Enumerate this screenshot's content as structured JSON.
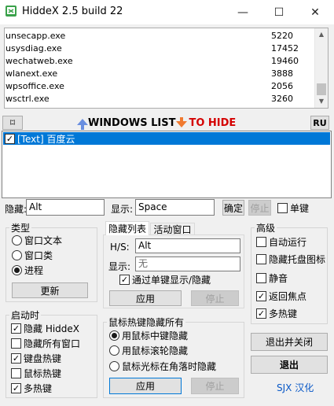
{
  "window": {
    "title": "HiddeX 2.5 build 22",
    "minimize_glyph": "—",
    "maximize_glyph": "☐",
    "close_glyph": "✕"
  },
  "process_list": [
    {
      "name": "unsecapp.exe",
      "pid": "5220"
    },
    {
      "name": "usysdiag.exe",
      "pid": "17452"
    },
    {
      "name": "wechatweb.exe",
      "pid": "19460"
    },
    {
      "name": "wlanext.exe",
      "pid": "3888"
    },
    {
      "name": "wpsoffice.exe",
      "pid": "2056"
    },
    {
      "name": "wsctrl.exe",
      "pid": "3260"
    }
  ],
  "list_header": {
    "pin_glyph": "⌑",
    "windows_list": "WINDOWS LIST",
    "to_hide": "TO HIDE",
    "ru_button": "RU"
  },
  "hide_list": [
    {
      "label": "[Text] 百度云",
      "checked": true
    }
  ],
  "hotkey_row": {
    "hide_label": "隐藏:",
    "hide_value": "Alt",
    "show_label": "显示:",
    "show_value": "Space",
    "ok_button": "确定",
    "stop_button": "停止",
    "single_key_label": "单键"
  },
  "type_group": {
    "title": "类型",
    "options": [
      "窗口文本",
      "窗口类",
      "进程"
    ],
    "selected_index": 2,
    "refresh_button": "更新"
  },
  "hotkey_tabs": {
    "tabs": [
      "隐藏列表",
      "活动窗口"
    ],
    "hs_label": "H/S:",
    "hs_value": "Alt",
    "show_label": "显示:",
    "show_value": "无",
    "single_key_toggle": "通过单键显示/隐藏",
    "apply_button": "应用",
    "stop_button": "停止"
  },
  "advanced_group": {
    "title": "高级",
    "options": [
      {
        "label": "自动运行",
        "checked": false
      },
      {
        "label": "隐藏托盘图标",
        "checked": false
      },
      {
        "label": "静音",
        "checked": false
      },
      {
        "label": "返回焦点",
        "checked": true
      },
      {
        "label": "多热键",
        "checked": true
      }
    ]
  },
  "startup_group": {
    "title": "启动时",
    "options": [
      {
        "label": "隐藏 HiddeX",
        "checked": true
      },
      {
        "label": "隐藏所有窗口",
        "checked": false
      },
      {
        "label": "键盘热键",
        "checked": true
      },
      {
        "label": "鼠标热键",
        "checked": false
      },
      {
        "label": "多热键",
        "checked": true
      }
    ]
  },
  "mouse_group": {
    "title": "鼠标热键隐藏所有",
    "options": [
      "用鼠标中键隐藏",
      "用鼠标滚轮隐藏",
      "鼠标光标在角落时隐藏"
    ],
    "selected_index": 0,
    "apply_button": "应用",
    "stop_button": "停止"
  },
  "actions": {
    "exit_and_close": "退出并关闭",
    "exit": "退出",
    "credit": "SJX 汉化"
  },
  "colors": {
    "selection": "#0078d7",
    "credit_text": "#0a59c7",
    "arrow_up": "#6a8fe0",
    "arrow_down": "#f07a30"
  }
}
